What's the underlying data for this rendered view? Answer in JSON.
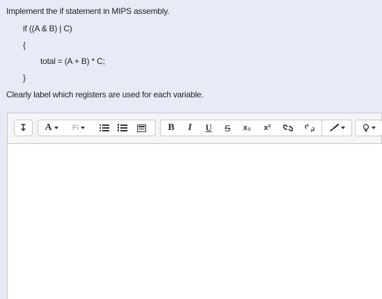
{
  "question": {
    "intro": "Implement the if statement in MIPS assembly.",
    "code_line1": "if ((A & B) | C)",
    "code_open_brace": "{",
    "code_body": "total = (A + B) * C;",
    "code_close_brace": "}",
    "instruction": "Clearly label which registers are used for each variable."
  },
  "toolbar": {
    "toggle_icon": "↧",
    "font_size_label": "A",
    "font_family_label": "Fi",
    "bold_label": "B",
    "italic_label": "I",
    "underline_label": "U",
    "strike_label": "S",
    "subscript_label": "x₂",
    "superscript_label": "x²"
  },
  "editor": {
    "content": ""
  }
}
